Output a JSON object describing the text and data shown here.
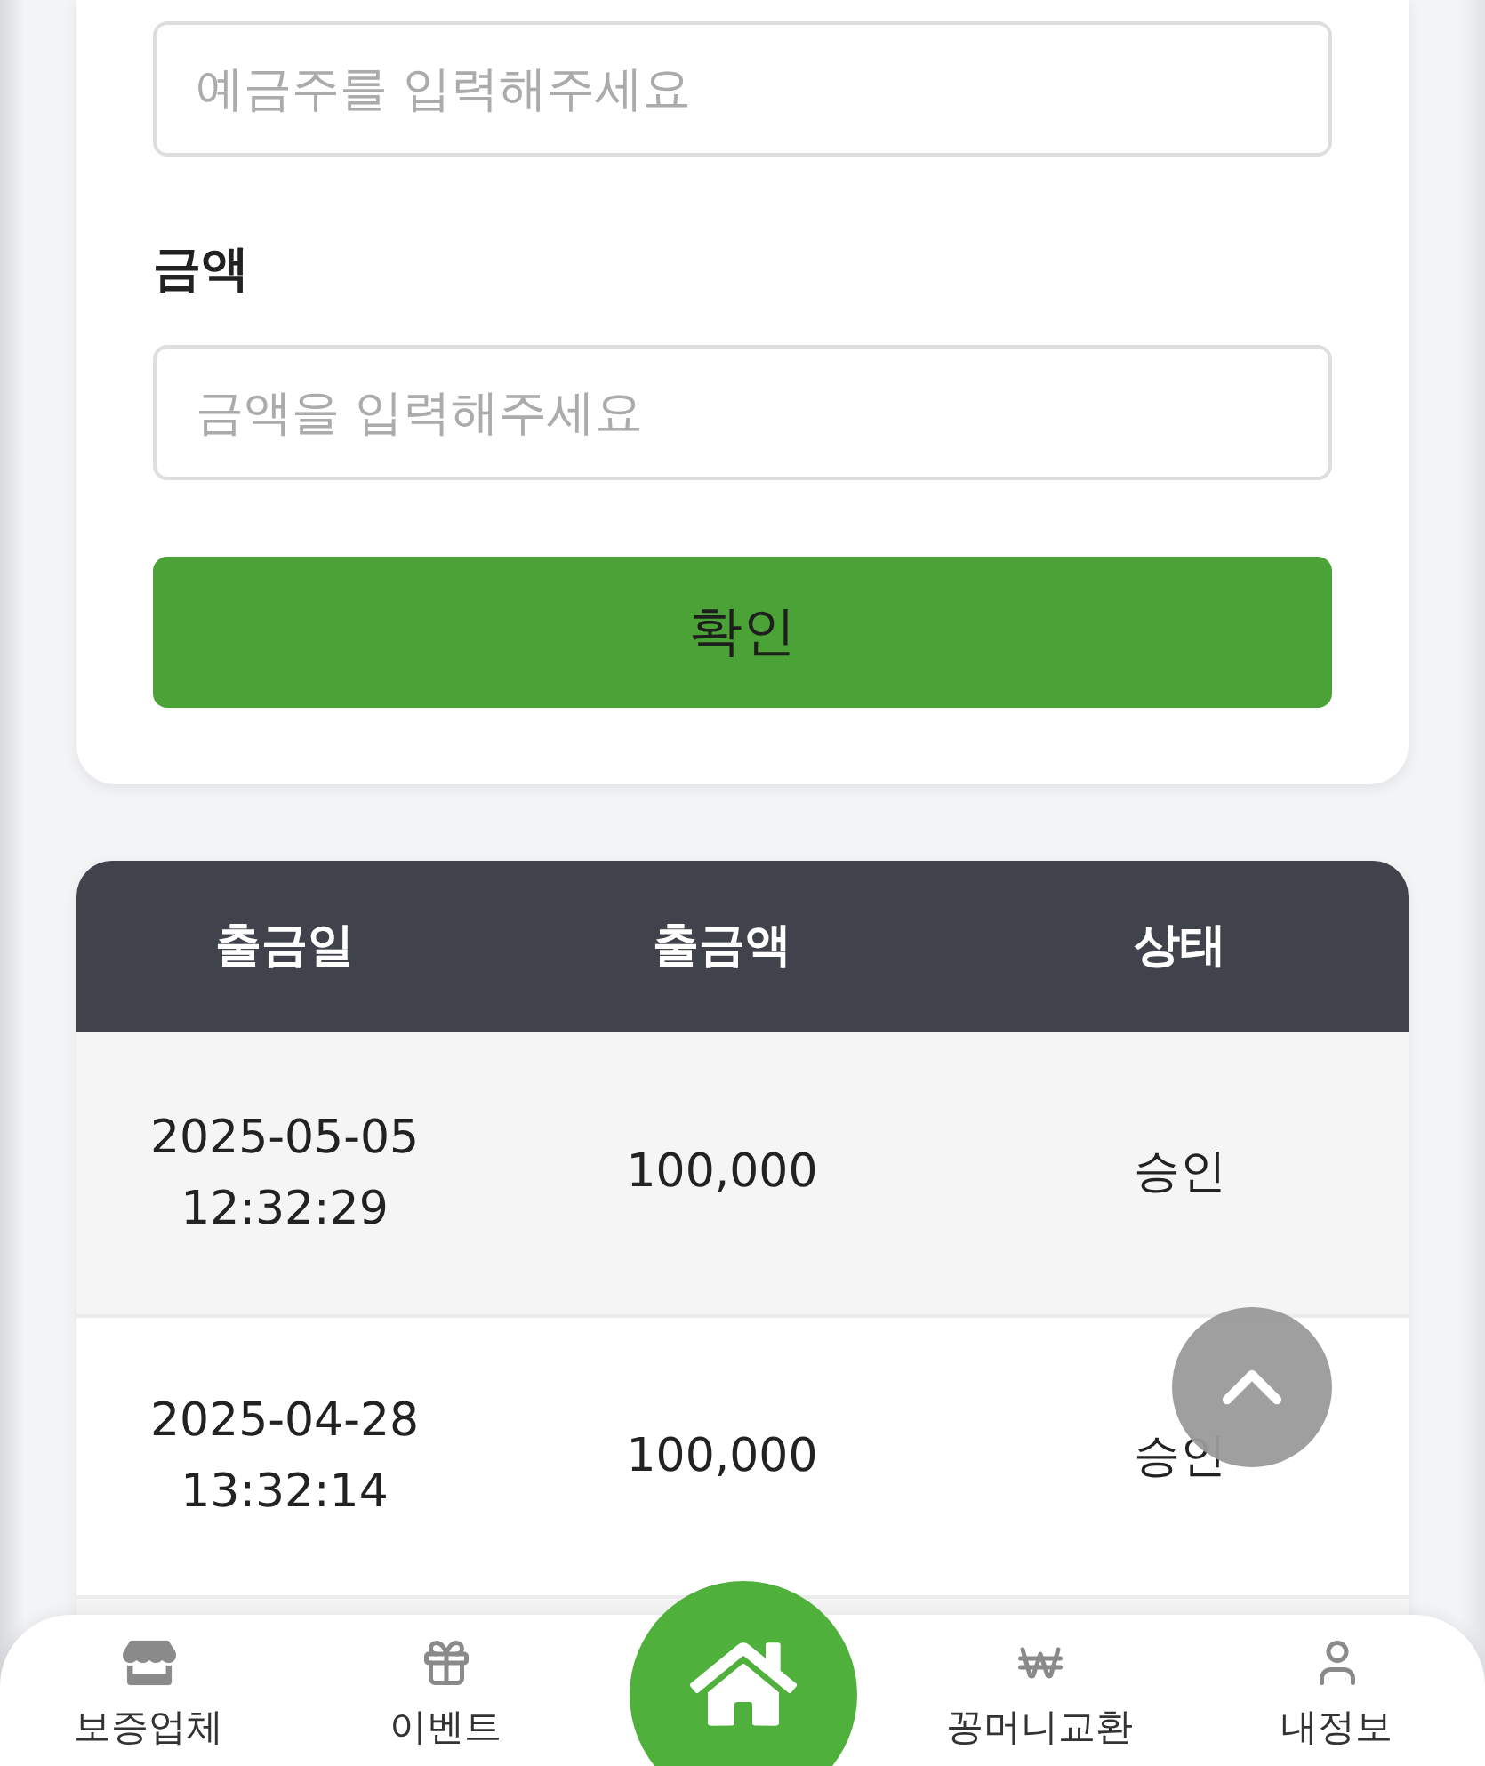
{
  "form": {
    "fields": [
      {
        "placeholder": "예금주를 입력해주세요"
      },
      {
        "label": "금액",
        "placeholder": "금액을 입력해주세요"
      }
    ],
    "submit": "확인"
  },
  "table": {
    "columns": [
      "출금일",
      "출금액",
      "상태"
    ],
    "rows": [
      {
        "datetime": "2025-05-05 12:32:29",
        "amount": "100,000",
        "status": "승인"
      },
      {
        "datetime": "2025-04-28 13:32:14",
        "amount": "100,000",
        "status": "승인"
      }
    ]
  },
  "bottom_nav": {
    "items": [
      {
        "kind": "tab",
        "label": "보증업체"
      },
      {
        "kind": "tab",
        "label": "이벤트"
      },
      {
        "kind": "home"
      },
      {
        "kind": "tab",
        "label": "꽁머니교환"
      },
      {
        "kind": "tab",
        "label": "내정보"
      }
    ]
  }
}
